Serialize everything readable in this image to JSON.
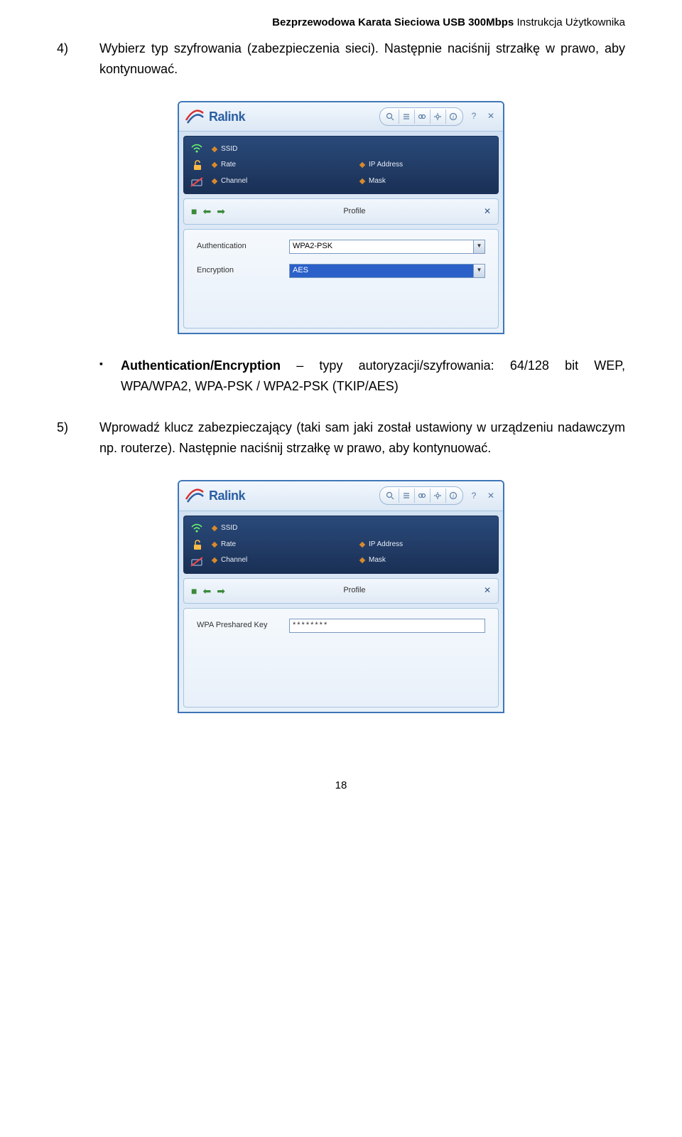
{
  "header": {
    "bold": "Bezprzewodowa Karata Sieciowa USB 300Mbps",
    "light": " Instrukcja Użytkownika"
  },
  "item4": {
    "num": "4)",
    "text": "Wybierz typ szyfrowania (zabezpieczenia sieci). Następnie naciśnij strzałkę w prawo, aby kontynuować."
  },
  "bullet": {
    "bold": "Authentication/Encryption",
    "text": " – typy autoryzacji/szyfrowania: 64/128 bit WEP, WPA/WPA2, WPA-PSK / WPA2-PSK (TKIP/AES)"
  },
  "item5": {
    "num": "5)",
    "text": "Wprowadź klucz zabezpieczający (taki sam jaki został ustawiony w urządzeniu nadawczym np. routerze). Następnie naciśnij strzałkę w prawo, aby kontynuować."
  },
  "app": {
    "brand": "Ralink",
    "profile_label": "Profile",
    "status": {
      "ssid": "SSID",
      "rate": "Rate",
      "channel": "Channel",
      "ip": "IP Address",
      "mask": "Mask"
    },
    "form1": {
      "auth_label": "Authentication",
      "auth_value": "WPA2-PSK",
      "enc_label": "Encryption",
      "enc_value": "AES"
    },
    "form2": {
      "key_label": "WPA Preshared Key",
      "key_value": "********"
    }
  },
  "page_number": "18"
}
